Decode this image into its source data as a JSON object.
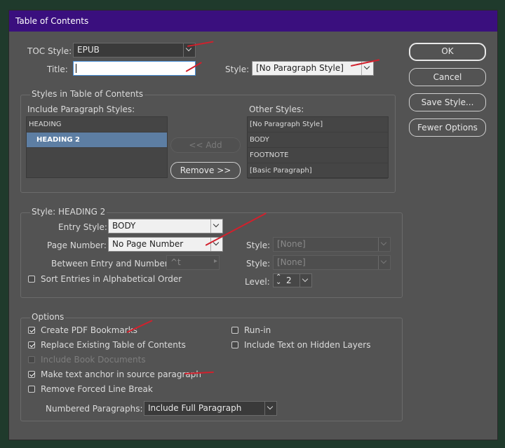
{
  "dialog": {
    "title": "Table of Contents",
    "toc_style_label": "TOC Style:",
    "toc_style_value": "EPUB",
    "title_label": "Title:",
    "title_value": "",
    "style_label": "Style:",
    "style_value": "[No Paragraph Style]"
  },
  "buttons": {
    "ok": "OK",
    "cancel": "Cancel",
    "save_style": "Save Style...",
    "fewer_options": "Fewer Options",
    "add": "<< Add",
    "remove": "Remove >>"
  },
  "styles_section": {
    "heading": "Styles in Table of Contents",
    "include_label": "Include Paragraph Styles:",
    "include_items": [
      "HEADING",
      "HEADING 2"
    ],
    "selected_index": 1,
    "other_label": "Other Styles:",
    "other_items": [
      "[No Paragraph Style]",
      "BODY",
      "FOOTNOTE",
      "[Basic Paragraph]"
    ]
  },
  "style_section": {
    "heading": "Style: HEADING 2",
    "entry_style_label": "Entry Style:",
    "entry_style_value": "BODY",
    "page_number_label": "Page Number:",
    "page_number_value": "No Page Number",
    "between_label": "Between Entry and Number:",
    "between_value": "^t",
    "style1_label": "Style:",
    "style1_value": "[None]",
    "style2_label": "Style:",
    "style2_value": "[None]",
    "sort_label": "Sort Entries in Alphabetical Order",
    "level_label": "Level:",
    "level_value": "2"
  },
  "options_section": {
    "heading": "Options",
    "create_pdf_bookmarks": "Create PDF Bookmarks",
    "replace_existing": "Replace Existing Table of Contents",
    "include_book_docs": "Include Book Documents",
    "make_text_anchor": "Make text anchor in source paragraph",
    "remove_forced_line_break": "Remove Forced Line Break",
    "run_in": "Run-in",
    "include_hidden_layers": "Include Text on Hidden Layers",
    "numbered_paragraphs_label": "Numbered Paragraphs:",
    "numbered_paragraphs_value": "Include Full Paragraph"
  },
  "colors": {
    "titlebar": "#3a0f7e",
    "panel": "#535353",
    "selection": "#5d7ea3",
    "annotation": "#d2202c"
  }
}
